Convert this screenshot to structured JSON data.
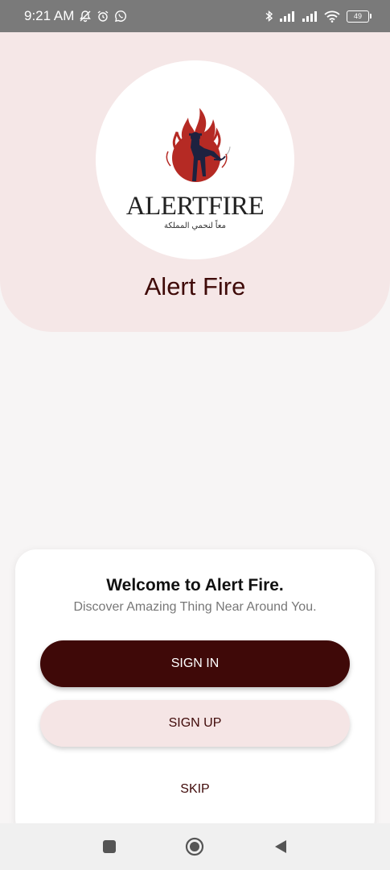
{
  "status_bar": {
    "time": "9:21 AM",
    "battery": "49",
    "left_icons": [
      "notifications-off-icon",
      "alarm-icon",
      "whatsapp-icon"
    ],
    "right_icons": [
      "bluetooth-icon",
      "signal-icon",
      "signal-icon",
      "wifi-icon",
      "battery-icon"
    ]
  },
  "header": {
    "logo_text": "ALERTFIRE",
    "logo_subtext": "معاً لنحمي المملكة",
    "app_title": "Alert Fire"
  },
  "card": {
    "title": "Welcome to Alert Fire.",
    "subtitle": "Discover Amazing Thing Near Around You.",
    "sign_in_label": "SIGN IN",
    "sign_up_label": "SIGN UP",
    "skip_label": "SKIP"
  },
  "nav_bar": {
    "icons": [
      "recent-apps-icon",
      "home-icon",
      "back-icon"
    ]
  },
  "colors": {
    "primary": "#3f0908",
    "header_bg": "#f5e7e7",
    "secondary_button": "#f5e5e5",
    "logo_red": "#b52a24"
  }
}
